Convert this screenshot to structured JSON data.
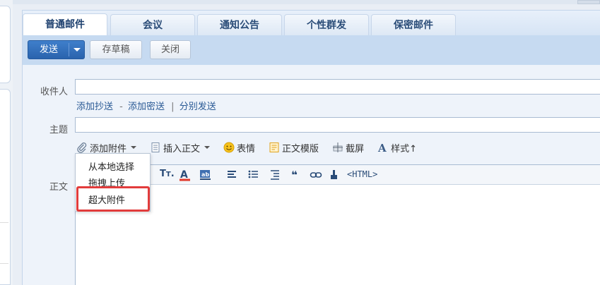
{
  "tabs": [
    {
      "label": "普通邮件",
      "active": true
    },
    {
      "label": "会议",
      "active": false
    },
    {
      "label": "通知公告",
      "active": false
    },
    {
      "label": "个性群发",
      "active": false
    },
    {
      "label": "保密邮件",
      "active": false
    }
  ],
  "toolbar": {
    "send_label": "发送",
    "draft_label": "存草稿",
    "close_label": "关闭"
  },
  "fields": {
    "to_label": "收件人",
    "to_value": "",
    "subject_label": "主题",
    "subject_value": "",
    "body_label": "正文"
  },
  "recipient_links": {
    "add_cc": "添加抄送",
    "dash": "-",
    "add_bcc": "添加密送",
    "bar": "|",
    "separate_send": "分别发送"
  },
  "attach_bar": {
    "add_attachment": "添加附件",
    "insert_body": "插入正文",
    "emoji": "表情",
    "template": "正文模版",
    "screenshot": "截屏",
    "style": "样式↑"
  },
  "editor_toolbar": {
    "html_label": "<HTML>"
  },
  "attachment_menu": {
    "items": [
      "从本地选择",
      "拖拽上传",
      "超大附件"
    ],
    "highlighted": "超大附件"
  },
  "colors": {
    "accent": "#2a63ad",
    "highlight": "#e23c3c",
    "link": "#2a5a95"
  }
}
